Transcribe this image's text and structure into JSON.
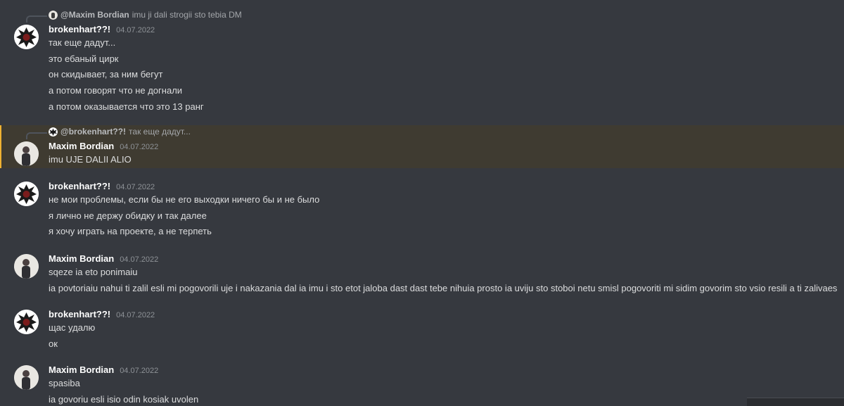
{
  "messages": [
    {
      "reply": {
        "author": "@Maxim Bordian",
        "text": "imu ji dali strogii sto tebia DM"
      },
      "author": "brokenhart??!",
      "date": "04.07.2022",
      "lines": [
        "так еще дадут...",
        "это ебаный цирк",
        "он скидывает, за ним бегут",
        "а потом говорят что не догнали",
        "а потом оказывается что это 13 ранг"
      ]
    },
    {
      "reply": {
        "author": "@brokenhart??!",
        "text": "так еще дадут..."
      },
      "author": "Maxim Bordian",
      "date": "04.07.2022",
      "highlight_color": "#f0b232",
      "lines": [
        "imu UJE DALII ALIO"
      ]
    },
    {
      "author": "brokenhart??!",
      "date": "04.07.2022",
      "lines": [
        "не мои проблемы, если бы не его выходки ничего бы и не было",
        "я лично не держу обидку и так далее",
        "я хочу играть на проекте, а не терпеть"
      ]
    },
    {
      "author": "Maxim Bordian",
      "date": "04.07.2022",
      "lines": [
        "sqeze ia eto ponimaiu",
        "ia povtoriaiu nahui ti zalil esli mi pogovorili uje i nakazania dal ia imu i sto etot  jaloba dast dast tebe nihuia prosto ia uviju sto stoboi netu smisl pogovoriti mi sidim govorim sto vsio resili a ti zalivaes"
      ]
    },
    {
      "author": "brokenhart??!",
      "date": "04.07.2022",
      "lines": [
        "щас удалю",
        "ок"
      ]
    },
    {
      "author": "Maxim Bordian",
      "date": "04.07.2022",
      "lines": [
        "spasiba",
        "ia govoriu esli isio odin kosiak uvolen"
      ]
    }
  ]
}
